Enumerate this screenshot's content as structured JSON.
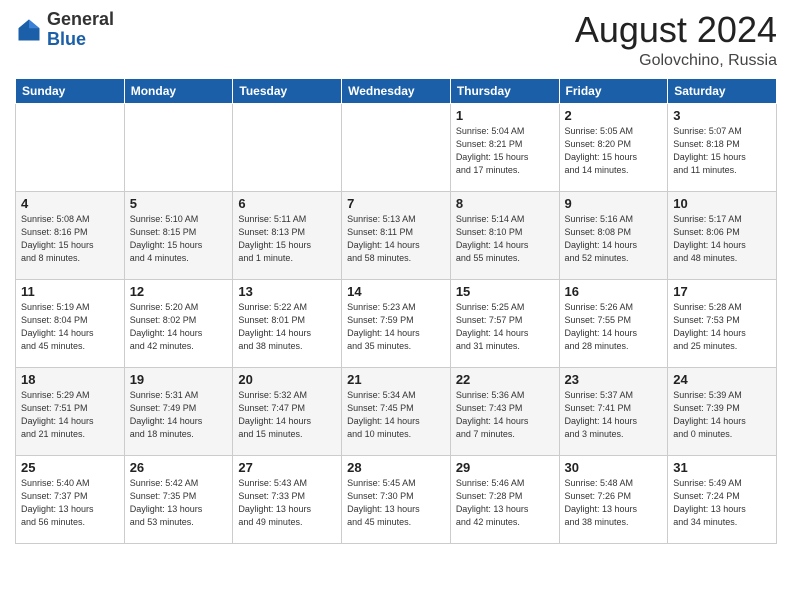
{
  "header": {
    "logo_general": "General",
    "logo_blue": "Blue",
    "month_year": "August 2024",
    "location": "Golovchino, Russia"
  },
  "days_of_week": [
    "Sunday",
    "Monday",
    "Tuesday",
    "Wednesday",
    "Thursday",
    "Friday",
    "Saturday"
  ],
  "weeks": [
    [
      {
        "day": "",
        "info": ""
      },
      {
        "day": "",
        "info": ""
      },
      {
        "day": "",
        "info": ""
      },
      {
        "day": "",
        "info": ""
      },
      {
        "day": "1",
        "info": "Sunrise: 5:04 AM\nSunset: 8:21 PM\nDaylight: 15 hours\nand 17 minutes."
      },
      {
        "day": "2",
        "info": "Sunrise: 5:05 AM\nSunset: 8:20 PM\nDaylight: 15 hours\nand 14 minutes."
      },
      {
        "day": "3",
        "info": "Sunrise: 5:07 AM\nSunset: 8:18 PM\nDaylight: 15 hours\nand 11 minutes."
      }
    ],
    [
      {
        "day": "4",
        "info": "Sunrise: 5:08 AM\nSunset: 8:16 PM\nDaylight: 15 hours\nand 8 minutes."
      },
      {
        "day": "5",
        "info": "Sunrise: 5:10 AM\nSunset: 8:15 PM\nDaylight: 15 hours\nand 4 minutes."
      },
      {
        "day": "6",
        "info": "Sunrise: 5:11 AM\nSunset: 8:13 PM\nDaylight: 15 hours\nand 1 minute."
      },
      {
        "day": "7",
        "info": "Sunrise: 5:13 AM\nSunset: 8:11 PM\nDaylight: 14 hours\nand 58 minutes."
      },
      {
        "day": "8",
        "info": "Sunrise: 5:14 AM\nSunset: 8:10 PM\nDaylight: 14 hours\nand 55 minutes."
      },
      {
        "day": "9",
        "info": "Sunrise: 5:16 AM\nSunset: 8:08 PM\nDaylight: 14 hours\nand 52 minutes."
      },
      {
        "day": "10",
        "info": "Sunrise: 5:17 AM\nSunset: 8:06 PM\nDaylight: 14 hours\nand 48 minutes."
      }
    ],
    [
      {
        "day": "11",
        "info": "Sunrise: 5:19 AM\nSunset: 8:04 PM\nDaylight: 14 hours\nand 45 minutes."
      },
      {
        "day": "12",
        "info": "Sunrise: 5:20 AM\nSunset: 8:02 PM\nDaylight: 14 hours\nand 42 minutes."
      },
      {
        "day": "13",
        "info": "Sunrise: 5:22 AM\nSunset: 8:01 PM\nDaylight: 14 hours\nand 38 minutes."
      },
      {
        "day": "14",
        "info": "Sunrise: 5:23 AM\nSunset: 7:59 PM\nDaylight: 14 hours\nand 35 minutes."
      },
      {
        "day": "15",
        "info": "Sunrise: 5:25 AM\nSunset: 7:57 PM\nDaylight: 14 hours\nand 31 minutes."
      },
      {
        "day": "16",
        "info": "Sunrise: 5:26 AM\nSunset: 7:55 PM\nDaylight: 14 hours\nand 28 minutes."
      },
      {
        "day": "17",
        "info": "Sunrise: 5:28 AM\nSunset: 7:53 PM\nDaylight: 14 hours\nand 25 minutes."
      }
    ],
    [
      {
        "day": "18",
        "info": "Sunrise: 5:29 AM\nSunset: 7:51 PM\nDaylight: 14 hours\nand 21 minutes."
      },
      {
        "day": "19",
        "info": "Sunrise: 5:31 AM\nSunset: 7:49 PM\nDaylight: 14 hours\nand 18 minutes."
      },
      {
        "day": "20",
        "info": "Sunrise: 5:32 AM\nSunset: 7:47 PM\nDaylight: 14 hours\nand 15 minutes."
      },
      {
        "day": "21",
        "info": "Sunrise: 5:34 AM\nSunset: 7:45 PM\nDaylight: 14 hours\nand 10 minutes."
      },
      {
        "day": "22",
        "info": "Sunrise: 5:36 AM\nSunset: 7:43 PM\nDaylight: 14 hours\nand 7 minutes."
      },
      {
        "day": "23",
        "info": "Sunrise: 5:37 AM\nSunset: 7:41 PM\nDaylight: 14 hours\nand 3 minutes."
      },
      {
        "day": "24",
        "info": "Sunrise: 5:39 AM\nSunset: 7:39 PM\nDaylight: 14 hours\nand 0 minutes."
      }
    ],
    [
      {
        "day": "25",
        "info": "Sunrise: 5:40 AM\nSunset: 7:37 PM\nDaylight: 13 hours\nand 56 minutes."
      },
      {
        "day": "26",
        "info": "Sunrise: 5:42 AM\nSunset: 7:35 PM\nDaylight: 13 hours\nand 53 minutes."
      },
      {
        "day": "27",
        "info": "Sunrise: 5:43 AM\nSunset: 7:33 PM\nDaylight: 13 hours\nand 49 minutes."
      },
      {
        "day": "28",
        "info": "Sunrise: 5:45 AM\nSunset: 7:30 PM\nDaylight: 13 hours\nand 45 minutes."
      },
      {
        "day": "29",
        "info": "Sunrise: 5:46 AM\nSunset: 7:28 PM\nDaylight: 13 hours\nand 42 minutes."
      },
      {
        "day": "30",
        "info": "Sunrise: 5:48 AM\nSunset: 7:26 PM\nDaylight: 13 hours\nand 38 minutes."
      },
      {
        "day": "31",
        "info": "Sunrise: 5:49 AM\nSunset: 7:24 PM\nDaylight: 13 hours\nand 34 minutes."
      }
    ]
  ]
}
